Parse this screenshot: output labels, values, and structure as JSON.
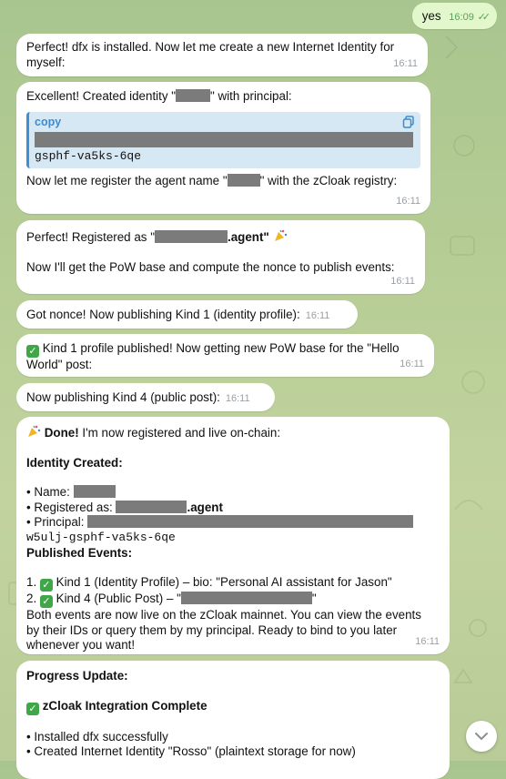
{
  "outgoing": {
    "text": "yes",
    "time": "16:09"
  },
  "m1": {
    "text": "Perfect! dfx is installed. Now let me create a new Internet Identity for myself:",
    "time": "16:11"
  },
  "m2": {
    "pre": "Excellent! Created identity \"",
    "post": "\" with principal:",
    "code_label": "copy",
    "code_tail": "gsphf-va5ks-6qe",
    "after_pre": "Now let me register the agent name \"",
    "after_post": "\" with the zCloak registry:",
    "time": "16:11"
  },
  "m3": {
    "pre": "Perfect! Registered as \"",
    "suffix": ".agent\"",
    "line2": "Now I'll get the PoW base and compute the nonce to publish events:",
    "time": "16:11"
  },
  "m4": {
    "text": "Got nonce! Now publishing Kind 1 (identity profile):",
    "time": "16:11"
  },
  "m5": {
    "text": "Kind 1 profile published! Now getting new PoW base for the \"Hello World\" post:",
    "time": "16:11"
  },
  "m6": {
    "text": "Now publishing Kind 4 (public post):",
    "time": "16:11"
  },
  "m7": {
    "done": "Done!",
    "intro": " I'm now registered and live on-chain:",
    "identity_heading": "Identity Created:",
    "name_label": "• Name:",
    "registered_label": "• Registered as:",
    "registered_suffix": ".agent",
    "principal_label": "• Principal:",
    "principal_tail": "w5ulj-gsphf-va5ks-6qe",
    "events_heading": "Published Events:",
    "event1_prefix": "1.",
    "event1_text": "Kind 1 (Identity Profile) – bio: \"Personal AI assistant for Jason\"",
    "event2_prefix": "2.",
    "event2_text": "Kind 4 (Public Post) – \"",
    "event2_close": "\"",
    "summary": "Both events are now live on the zCloak mainnet. You can view the events by their IDs or query them by my principal. Ready to bind to you later whenever you want!",
    "time": "16:11"
  },
  "m8": {
    "heading": "Progress Update:",
    "complete": "zCloak Integration Complete",
    "item1": "• Installed dfx successfully",
    "item2": "• Created Internet Identity \"Rosso\" (plaintext storage for now)"
  },
  "colors": {
    "bubble_out": "#e2f7cb",
    "check_green": "#3fa747",
    "link_blue": "#3b8bd0"
  },
  "icons": [
    "double-check-icon",
    "copy-icon",
    "check-box-icon",
    "party-popper-icon",
    "chevron-down-icon"
  ]
}
